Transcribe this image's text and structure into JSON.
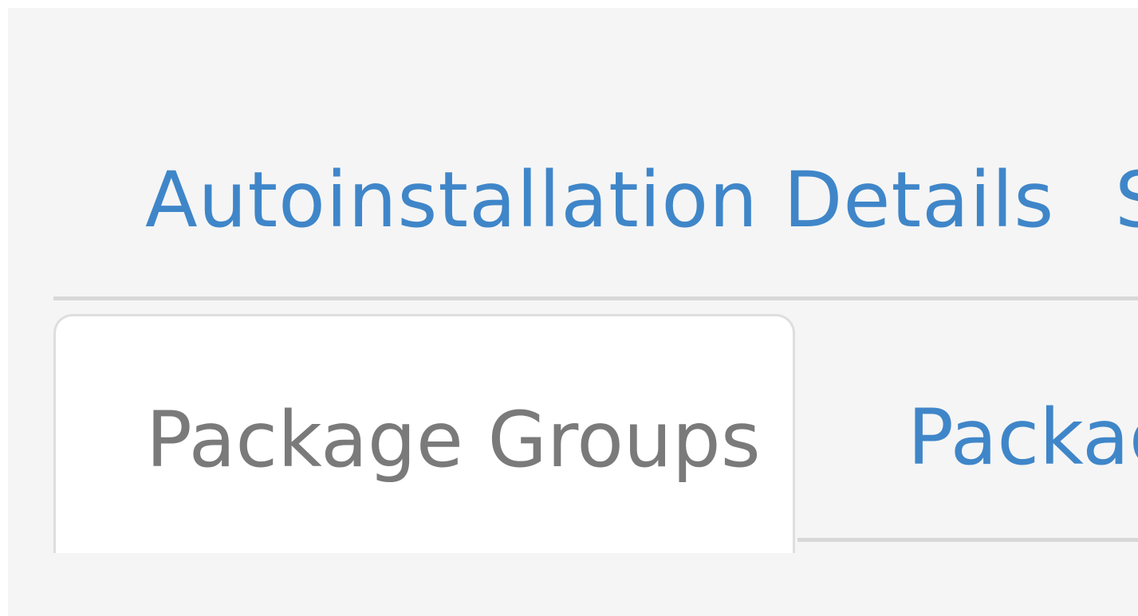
{
  "nav": {
    "links": [
      {
        "label": "Autoinstallation Details"
      },
      {
        "label": "S"
      }
    ]
  },
  "tabs": [
    {
      "label": "Package Groups",
      "active": true
    },
    {
      "label": "Packag",
      "active": false
    }
  ],
  "colors": {
    "link": "#3f86c9",
    "active_tab_text": "#7a7a7a",
    "background": "#f5f5f5",
    "divider": "#d8d8d8"
  }
}
